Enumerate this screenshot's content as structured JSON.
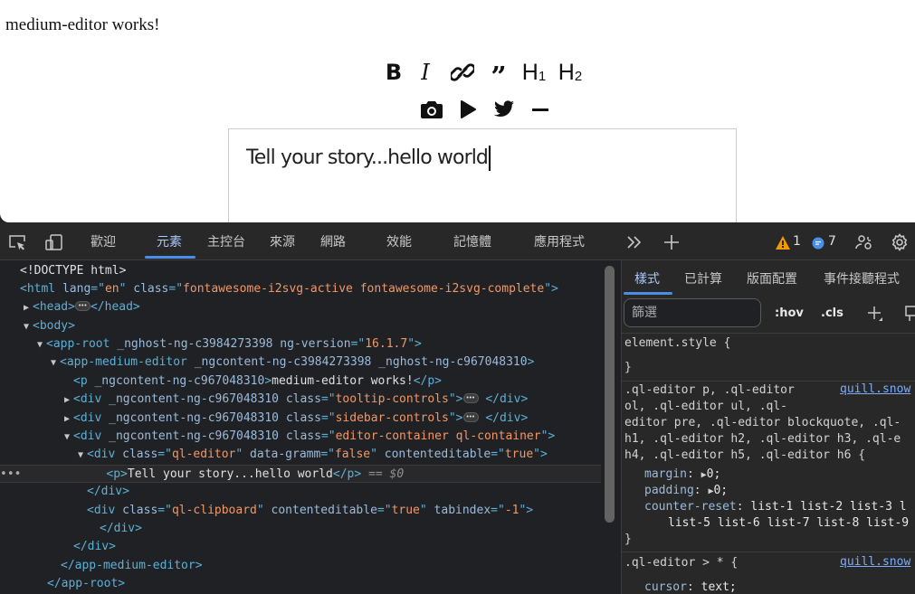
{
  "page": {
    "heading": "medium-editor works!",
    "toolbar_top": [
      {
        "name": "bold",
        "label": "B"
      },
      {
        "name": "italic",
        "label": "I"
      },
      {
        "name": "link",
        "label": ""
      },
      {
        "name": "quote",
        "label": "”"
      },
      {
        "name": "h1",
        "label": "H",
        "sub": "1"
      },
      {
        "name": "h2",
        "label": "H",
        "sub": "2"
      }
    ],
    "toolbar_bottom": [
      "camera-icon",
      "play-icon",
      "twitter-icon",
      "divider-icon"
    ],
    "editor_text": "Tell your story...hello world"
  },
  "devtools": {
    "tabs": [
      "歡迎",
      "元素",
      "主控台",
      "來源",
      "網路",
      "效能",
      "記憶體",
      "應用程式"
    ],
    "active_tab": "元素",
    "warning_count": "1",
    "message_count": "7",
    "accent": "#4a8fe7"
  },
  "tree": {
    "doctype": "<!DOCTYPE html>",
    "html_attrs": {
      "lang": "en",
      "class": "fontawesome-i2svg-active fontawesome-i2svg-complete"
    },
    "app_root": {
      "a1": "_nghost-ng-c3984273398",
      "a2": "ng-version",
      "v2": "16.1.7"
    },
    "app_medium_editor": {
      "a1": "_ngcontent-ng-c3984273398",
      "a2": "_nghost-ng-c967048310"
    },
    "p_text": "medium-editor works!",
    "ngcontent": "_ngcontent-ng-c967048310",
    "tooltip_class": "tooltip-controls",
    "sidebar_class": "sidebar-controls",
    "container_class": "editor-container ql-container",
    "qleditor": {
      "class": "ql-editor",
      "gramm": "false",
      "contenteditable": "true"
    },
    "selected_text": "Tell your story...hello world",
    "selected_marker": "== $0",
    "clipboard": {
      "class": "ql-clipboard",
      "contenteditable": "true",
      "tabindex": "-1"
    }
  },
  "styles": {
    "tabs": [
      "樣式",
      "已計算",
      "版面配置",
      "事件接聽程式"
    ],
    "filter_placeholder": "篩選",
    "hov": ":hov",
    "cls": ".cls",
    "element_style": "element.style {",
    "rule1_selector": [
      ".ql-editor p, .ql-editor",
      "ol, .ql-editor ul, .ql-",
      "editor pre, .ql-editor blockquote, .ql-",
      "h1, .ql-editor h2, .ql-editor h3, .ql-e",
      "h4, .ql-editor h5, .ql-editor h6 {"
    ],
    "rule1_source": "quill.snow",
    "margin": "margin",
    "padding": "padding",
    "zero": "0;",
    "counter_reset": "counter-reset",
    "counter_val1": "list-1 list-2 list-3 l",
    "counter_val2": "list-5 list-6 list-7 list-8 list-9",
    "rule2_selector": ".ql-editor > * {",
    "rule2_source": "quill.snow",
    "cursor": "cursor",
    "cursor_val": "text;"
  }
}
